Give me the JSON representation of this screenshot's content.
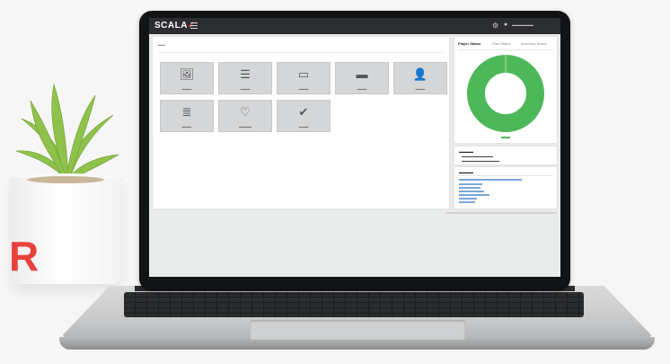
{
  "scene": {
    "brand_letter": "R",
    "colors": {
      "accent_red": "#e8413c",
      "donut_green": "#4db85a",
      "topbar": "#2b2d30"
    }
  },
  "app": {
    "logo_text": "SCALA",
    "logo_mark": "✓",
    "icons": [
      "menu-icon",
      "gear-icon",
      "user-icon"
    ],
    "tiles": [
      {
        "name": "media",
        "glyph": "🖼"
      },
      {
        "name": "playlists",
        "glyph": "☰"
      },
      {
        "name": "channels",
        "glyph": "▭"
      },
      {
        "name": "players",
        "glyph": "▬"
      },
      {
        "name": "users",
        "glyph": "👤"
      },
      {
        "name": "servers",
        "glyph": "≣"
      },
      {
        "name": "player-platforms",
        "glyph": "♡"
      },
      {
        "name": "approvals",
        "glyph": "✔"
      }
    ],
    "status_panel": {
      "tabs": [
        "Player Status",
        "Plan Status",
        "Inventory Status"
      ],
      "donut_fraction_green": 1.0
    }
  }
}
